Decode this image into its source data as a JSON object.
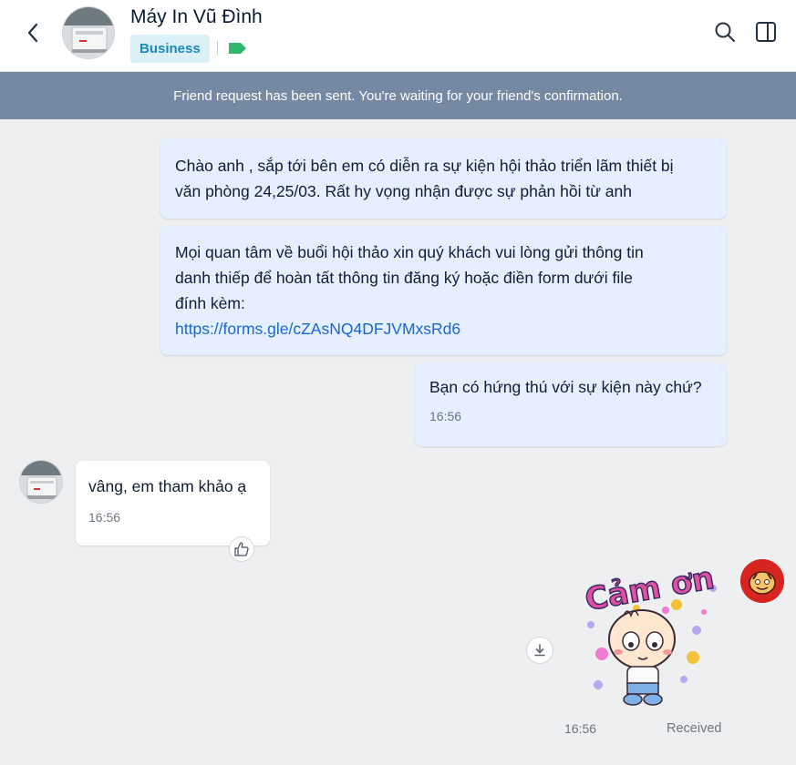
{
  "header": {
    "contact_name": "Máy In Vũ Đình",
    "badge": "Business",
    "icons": {
      "back": "back-arrow-icon",
      "search": "search-icon",
      "sidebar": "sidebar-toggle-icon",
      "tag": "label-tag-icon"
    },
    "tag_color": "#2fb86b"
  },
  "banner": {
    "text": "Friend request has been sent. You're waiting for your friend's confirmation."
  },
  "messages": [
    {
      "sender": "me",
      "lines": [
        "Chào anh , sắp tới bên em có diễn ra sự kiện hội thảo triển lãm thiết bị",
        "văn phòng 24,25/03. Rất hy vọng nhận được sự phản hồi từ anh"
      ]
    },
    {
      "sender": "me",
      "lines": [
        "Mọi quan tâm về buổi hội thảo xin quý khách vui lòng gửi thông tin",
        "danh thiếp để hoàn tất thông tin đăng ký hoặc điền form dưới file",
        "đính kèm:"
      ],
      "link": "https://forms.gle/cZAsNQ4DFJVMxsRd6"
    },
    {
      "sender": "me",
      "lines": [
        "Bạn có hứng thú với sự kiện này chứ?"
      ],
      "time": "16:56"
    },
    {
      "sender": "them",
      "lines": [
        "vâng, em tham khảo ạ"
      ],
      "time": "16:56"
    },
    {
      "sender": "me",
      "sticker": {
        "text": "Cảm ơn"
      },
      "time": "16:56",
      "status": "Received"
    }
  ],
  "colors": {
    "my_bubble": "#e5efff",
    "their_bubble": "#ffffff",
    "banner": "#7689a2",
    "link": "#1867d6",
    "badge_text": "#1a8ab8",
    "badge_bg": "#dcf0f7"
  }
}
